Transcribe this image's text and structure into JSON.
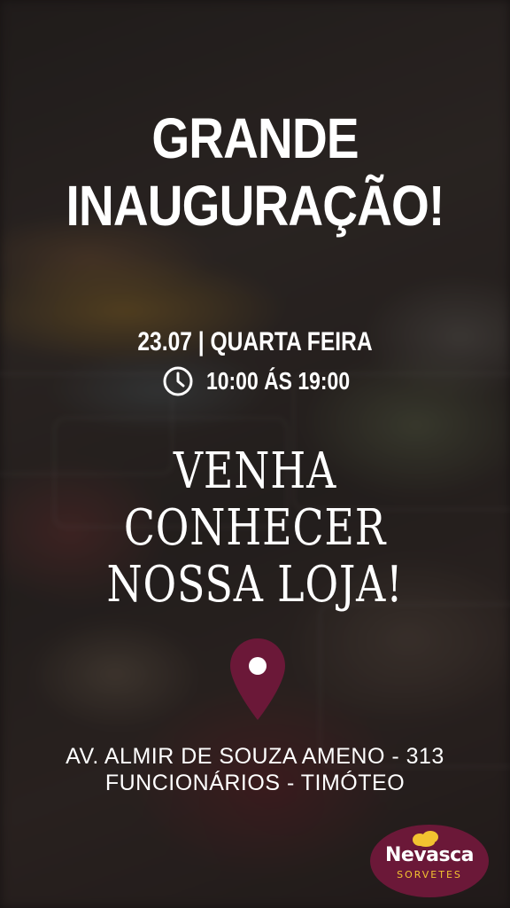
{
  "headline": {
    "line1": "GRANDE",
    "line2": "INAUGURAÇÃO!"
  },
  "event": {
    "date": "23.07 | QUARTA FEIRA",
    "time": "10:00 ÁS 19:00"
  },
  "invitation": {
    "line1": "VENHA",
    "line2": "CONHECER",
    "line3": "NOSSA LOJA!"
  },
  "location": {
    "address_line1": "AV. ALMIR DE SOUZA AMENO - 313",
    "address_line2": "FUNCIONÁRIOS - TIMÓTEO"
  },
  "brand": {
    "name": "Nevasca",
    "tagline": "SORVETES",
    "primary_color": "#6b1838",
    "accent_color": "#f2c230"
  },
  "icons": {
    "clock": "clock-icon",
    "location": "map-pin-icon",
    "logo_mark": "ice-cream-mark-icon"
  }
}
